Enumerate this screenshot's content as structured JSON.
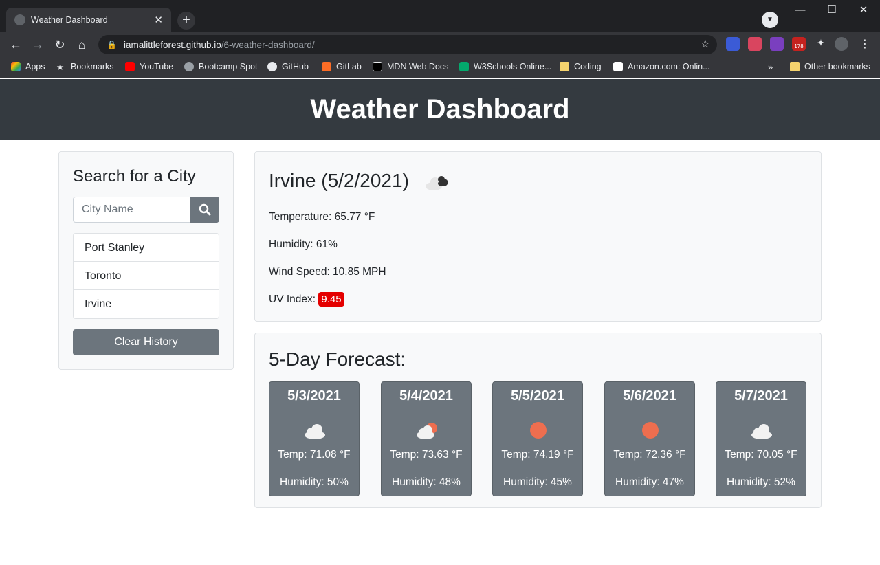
{
  "browser": {
    "tab_title": "Weather Dashboard",
    "url_host": "iamalittleforest.github.io",
    "url_path": "/6-weather-dashboard/",
    "extension_badge": "178",
    "bookmarks": [
      "Apps",
      "Bookmarks",
      "YouTube",
      "Bootcamp Spot",
      "GitHub",
      "GitLab",
      "MDN Web Docs",
      "W3Schools Online...",
      "Coding",
      "Amazon.com: Onlin..."
    ],
    "more_bookmarks": "»",
    "other_bookmarks": "Other bookmarks"
  },
  "header": {
    "title": "Weather Dashboard"
  },
  "sidebar": {
    "heading": "Search for a City",
    "search_placeholder": "City Name",
    "history": [
      "Port Stanley",
      "Toronto",
      "Irvine"
    ],
    "clear_label": "Clear History"
  },
  "current": {
    "title": "Irvine (5/2/2021)",
    "icon": "broken-clouds-icon",
    "temperature": "Temperature: 65.77 °F",
    "humidity": "Humidity: 61%",
    "wind": "Wind Speed: 10.85 MPH",
    "uv_label": "UV Index: ",
    "uv_value": "9.45",
    "uv_color": "#e40000"
  },
  "forecast": {
    "heading": "5-Day Forecast:",
    "days": [
      {
        "date": "5/3/2021",
        "icon": "cloud-icon",
        "temp": "Temp: 71.08 °F",
        "humidity": "Humidity: 50%"
      },
      {
        "date": "5/4/2021",
        "icon": "partly-cloudy-icon",
        "temp": "Temp: 73.63 °F",
        "humidity": "Humidity: 48%"
      },
      {
        "date": "5/5/2021",
        "icon": "sun-icon",
        "temp": "Temp: 74.19 °F",
        "humidity": "Humidity: 45%"
      },
      {
        "date": "5/6/2021",
        "icon": "sun-icon",
        "temp": "Temp: 72.36 °F",
        "humidity": "Humidity: 47%"
      },
      {
        "date": "5/7/2021",
        "icon": "cloud-icon",
        "temp": "Temp: 70.05 °F",
        "humidity": "Humidity: 52%"
      }
    ]
  },
  "colors": {
    "header_bg": "#343a40",
    "card_bg": "#6c757d",
    "sun": "#ee6e4f"
  }
}
